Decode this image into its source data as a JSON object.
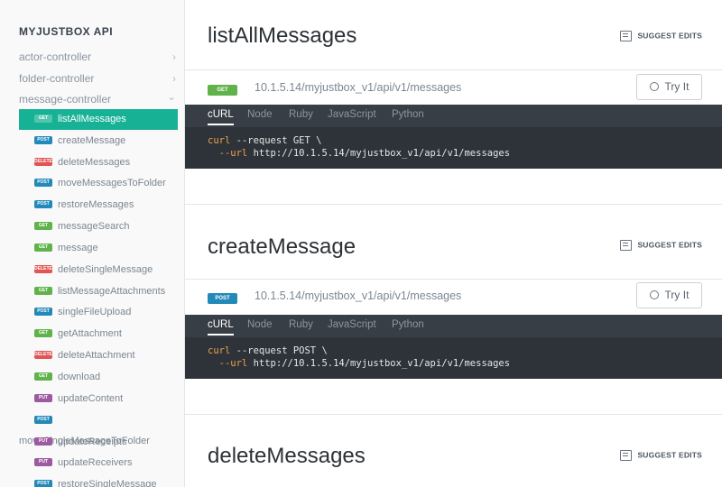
{
  "sidebar": {
    "title": "MYJUSTBOX API",
    "groups": [
      {
        "label": "actor-controller",
        "chevron": "›"
      },
      {
        "label": "folder-controller",
        "chevron": "›"
      },
      {
        "label": "message-controller",
        "chevron": "⌄"
      }
    ],
    "items": [
      {
        "method": "GET",
        "label": "listAllMessages"
      },
      {
        "method": "POST",
        "label": "createMessage"
      },
      {
        "method": "DELETE",
        "label": "deleteMessages"
      },
      {
        "method": "POST",
        "label": "moveMessagesToFolder"
      },
      {
        "method": "POST",
        "label": "restoreMessages"
      },
      {
        "method": "GET",
        "label": "messageSearch"
      },
      {
        "method": "GET",
        "label": "message"
      },
      {
        "method": "DELETE",
        "label": "deleteSingleMessage"
      },
      {
        "method": "GET",
        "label": "listMessageAttachments"
      },
      {
        "method": "POST",
        "label": "singleFileUpload"
      },
      {
        "method": "GET",
        "label": "getAttachment"
      },
      {
        "method": "DELETE",
        "label": "deleteAttachment"
      },
      {
        "method": "GET",
        "label": "download"
      },
      {
        "method": "PUT",
        "label": "updateContent"
      },
      {
        "method": "POST",
        "label": "moveSingleMessageToFolder"
      },
      {
        "method": "PUT",
        "label": "updateReceipts"
      },
      {
        "method": "PUT",
        "label": "updateReceivers"
      },
      {
        "method": "POST",
        "label": "restoreSingleMessage"
      }
    ]
  },
  "suggest_label": "SUGGEST EDITS",
  "tryit_label": "Try It",
  "tabs": [
    "cURL",
    "Node",
    "Ruby",
    "JavaScript",
    "Python"
  ],
  "sections": [
    {
      "title": "listAllMessages",
      "method": "GET",
      "url": "10.1.5.14/myjustbox_v1/api/v1/messages",
      "code_line1_cmd": "curl",
      "code_line1_rest": " --request GET \\",
      "code_line2_flag": "  --url",
      "code_line2_rest": " http://10.1.5.14/myjustbox_v1/api/v1/messages"
    },
    {
      "title": "createMessage",
      "method": "POST",
      "url": "10.1.5.14/myjustbox_v1/api/v1/messages",
      "code_line1_cmd": "curl",
      "code_line1_rest": " --request POST \\",
      "code_line2_flag": "  --url",
      "code_line2_rest": " http://10.1.5.14/myjustbox_v1/api/v1/messages"
    },
    {
      "title": "deleteMessages"
    }
  ],
  "colors": {
    "accent": "#17b295",
    "get": "#5fb34a",
    "post": "#2389b8",
    "delete": "#e25555",
    "put": "#9d5aa0",
    "code_bg": "#2d3339"
  },
  "icons": {
    "suggest": "pencil-square-icon",
    "tryit": "circle-play-icon",
    "chevron_right": "chevron-right-icon",
    "chevron_down": "chevron-down-icon"
  }
}
